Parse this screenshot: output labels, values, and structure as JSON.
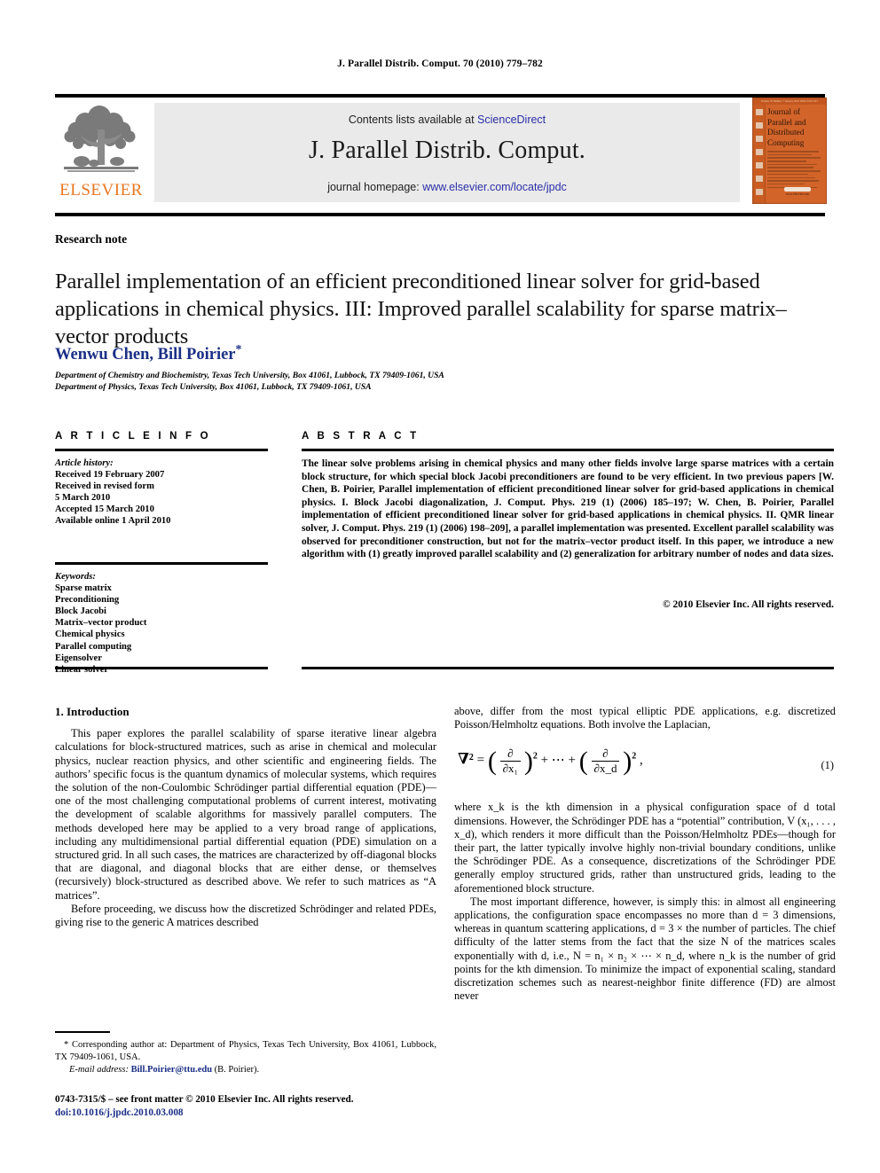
{
  "running_head": "J. Parallel Distrib. Comput. 70 (2010) 779–782",
  "masthead": {
    "contents_prefix": "Contents lists available at ",
    "sciencedirect": "ScienceDirect",
    "journal_title": "J. Parallel Distrib. Comput.",
    "homepage_prefix": "journal homepage: ",
    "homepage_url": "www.elsevier.com/locate/jpdc",
    "publisher": "ELSEVIER",
    "logo_icon": "elsevier-tree-logo",
    "accent_orange": "#E87722",
    "link_blue": "#2b2fa8",
    "banner_gray": "#eaeaea"
  },
  "cover": {
    "line1": "Journal of",
    "line2": "Parallel and",
    "line3": "Distributed",
    "line4": "Computing",
    "topbar": "Volume 70   Number 7   January 2010   ISSN 0743-7315",
    "sciencedirect_badge": "ScienceDirect",
    "sciencedirect_url": "www.elsevier.com",
    "background": "#D2642A"
  },
  "article": {
    "type": "Research note",
    "title": "Parallel implementation of an efficient preconditioned linear solver for grid-based applications in chemical physics. III: Improved parallel scalability for sparse matrix–vector products",
    "authors": "Wenwu Chen, Bill Poirier",
    "author_star": "*",
    "author_color": "#1b2f86",
    "affiliation_1": "Department of Chemistry and Biochemistry, Texas Tech University, Box 41061, Lubbock, TX 79409-1061, USA",
    "affiliation_2": "Department of Physics, Texas Tech University, Box 41061, Lubbock, TX 79409-1061, USA"
  },
  "info": {
    "heading": "A R T I C L E    I N F O",
    "history_label": "Article history:",
    "history": [
      "Received 19 February 2007",
      "Received in revised form",
      "5 March 2010",
      "Accepted 15 March 2010",
      "Available online 1 April 2010"
    ],
    "keywords_label": "Keywords:",
    "keywords": [
      "Sparse matrix",
      "Preconditioning",
      "Block Jacobi",
      "Matrix–vector product",
      "Chemical physics",
      "Parallel computing",
      "Eigensolver",
      "Linear solver"
    ]
  },
  "abstract": {
    "heading": "A B S T R A C T",
    "text": "The linear solve problems arising in chemical physics and many other fields involve large sparse matrices with a certain block structure, for which special block Jacobi preconditioners are found to be very efficient. In two previous papers [W. Chen, B. Poirier, Parallel implementation of efficient preconditioned linear solver for grid-based applications in chemical physics. I. Block Jacobi diagonalization, J. Comput. Phys. 219 (1) (2006) 185–197; W. Chen, B. Poirier, Parallel implementation of efficient preconditioned linear solver for grid-based applications in chemical physics. II. QMR linear solver, J. Comput. Phys. 219 (1) (2006) 198–209], a parallel implementation was presented. Excellent parallel scalability was observed for preconditioner construction, but not for the matrix–vector product itself. In this paper, we introduce a new algorithm with (1) greatly improved parallel scalability and (2) generalization for arbitrary number of nodes and data sizes.",
    "copyright": "© 2010 Elsevier Inc. All rights reserved."
  },
  "body": {
    "section_number_title": "1. Introduction",
    "left_p1": "This paper explores the parallel scalability of sparse iterative linear algebra calculations for block-structured matrices, such as arise in chemical and molecular physics, nuclear reaction physics, and other scientific and engineering fields. The authors’ specific focus is the quantum dynamics of molecular systems, which requires the solution of the non-Coulombic Schrödinger partial differential equation (PDE)—one of the most challenging computational problems of current interest, motivating the development of scalable algorithms for massively parallel computers. The methods developed here may be applied to a very broad range of applications, including any multidimensional partial differential equation (PDE) simulation on a structured grid. In all such cases, the matrices are characterized by off-diagonal blocks that are diagonal, and diagonal blocks that are either dense, or themselves (recursively) block-structured as described above. We refer to such matrices as “A matrices”.",
    "left_p2": "Before proceeding, we discuss how the discretized Schrödinger and related PDEs, giving rise to the generic A matrices described",
    "right_p1": "above, differ from the most typical elliptic PDE applications, e.g. discretized Poisson/Helmholtz equations. Both involve the Laplacian,",
    "equation_number": "(1)",
    "equation_parts": {
      "lhs": "∇²",
      "numerator": "∂",
      "denominator_1": "∂x₁",
      "denominator_d": "∂x_d",
      "exponent": "2",
      "middle": "+ ⋯ +",
      "trailing": ","
    },
    "right_p2": "where x_k is the kth dimension in a physical configuration space of d total dimensions. However, the Schrödinger PDE has a “potential” contribution, V (x₁, . . . , x_d), which renders it more difficult than the Poisson/Helmholtz PDEs—though for their part, the latter typically involve highly non-trivial boundary conditions, unlike the Schrödinger PDE. As a consequence, discretizations of the Schrödinger PDE generally employ structured grids, rather than unstructured grids, leading to the aforementioned block structure.",
    "right_p3": "The most important difference, however, is simply this: in almost all engineering applications, the configuration space encompasses no more than d = 3 dimensions, whereas in quantum scattering applications, d = 3 × the number of particles. The chief difficulty of the latter stems from the fact that the size N of the matrices scales exponentially with d, i.e., N = n₁ × n₂ × ⋯ × n_d, where n_k is the number of grid points for the kth dimension. To minimize the impact of exponential scaling, standard discretization schemes such as nearest-neighbor finite difference (FD) are almost never"
  },
  "footnote": {
    "line1": "* Corresponding author at: Department of Physics, Texas Tech University, Box 41061, Lubbock, TX 79409-1061, USA.",
    "email_label": "E-mail address:",
    "email": "Bill.Poirier@ttu.edu",
    "email_suffix": " (B. Poirier)."
  },
  "footer": {
    "issn_line": "0743-7315/$ – see front matter © 2010 Elsevier Inc. All rights reserved.",
    "doi": "doi:10.1016/j.jpdc.2010.03.008"
  }
}
